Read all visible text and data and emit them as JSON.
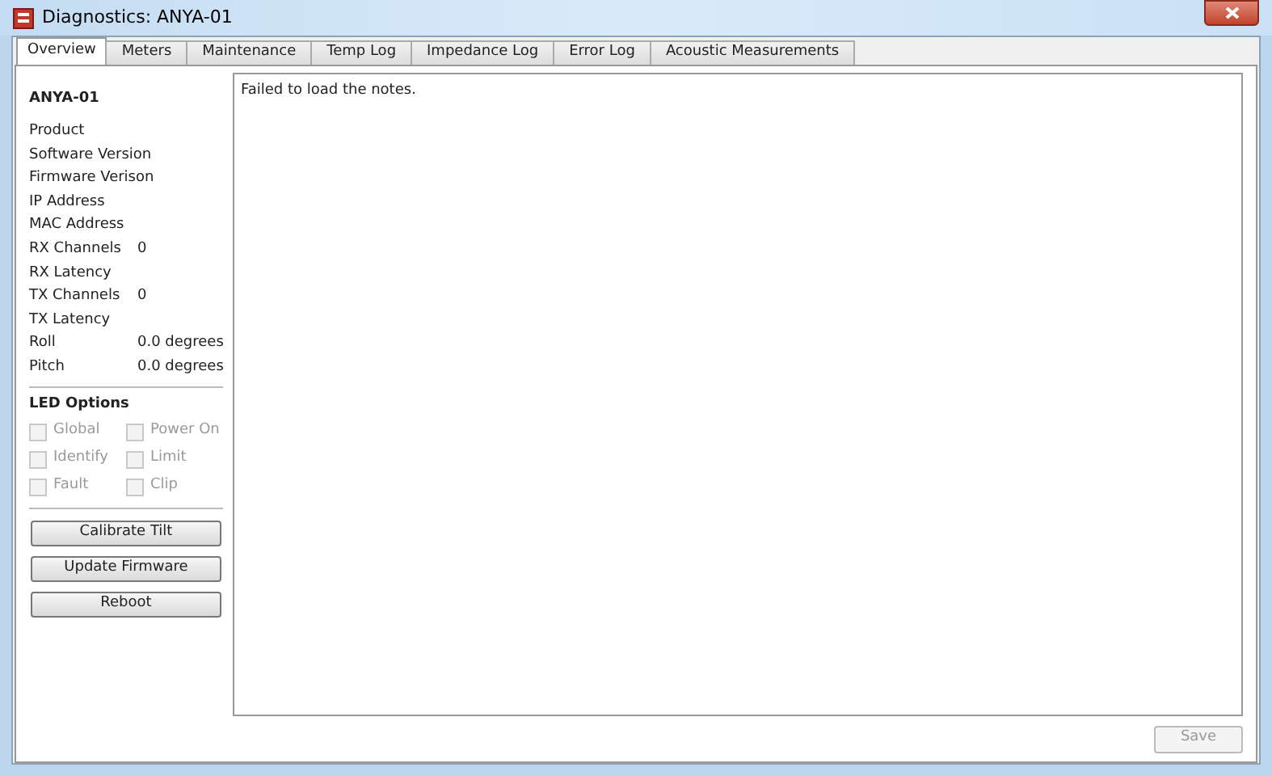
{
  "window": {
    "title": "Diagnostics: ANYA-01"
  },
  "tabs": [
    {
      "label": "Overview",
      "selected": true
    },
    {
      "label": "Meters",
      "selected": false
    },
    {
      "label": "Maintenance",
      "selected": false
    },
    {
      "label": "Temp Log",
      "selected": false
    },
    {
      "label": "Impedance Log",
      "selected": false
    },
    {
      "label": "Error Log",
      "selected": false
    },
    {
      "label": "Acoustic Measurements",
      "selected": false
    }
  ],
  "device": {
    "name": "ANYA-01",
    "properties": [
      {
        "label": "Product"
      },
      {
        "label": "Software Version"
      },
      {
        "label": "Firmware Verison"
      },
      {
        "label": "IP Address"
      },
      {
        "label": "MAC Address"
      },
      {
        "label": "RX Channels",
        "value": "0"
      },
      {
        "label": "RX Latency"
      },
      {
        "label": "TX Channels",
        "value": "0"
      },
      {
        "label": "TX Latency"
      },
      {
        "label": "Roll",
        "value": "0.0 degrees"
      },
      {
        "label": "Pitch",
        "value": "0.0 degrees"
      }
    ]
  },
  "led_options": {
    "title": "LED Options",
    "items": [
      {
        "label": "Global",
        "checked": false,
        "disabled": true
      },
      {
        "label": "Power On",
        "checked": false,
        "disabled": true
      },
      {
        "label": "Identify",
        "checked": false,
        "disabled": true
      },
      {
        "label": "Limit",
        "checked": false,
        "disabled": true
      },
      {
        "label": "Fault",
        "checked": false,
        "disabled": true
      },
      {
        "label": "Clip",
        "checked": false,
        "disabled": true
      }
    ]
  },
  "actions": [
    {
      "label": "Calibrate Tilt"
    },
    {
      "label": "Update Firmware"
    },
    {
      "label": "Reboot"
    }
  ],
  "notes": {
    "message": "Failed to load the notes."
  },
  "save_button": {
    "label": "Save",
    "disabled": true
  }
}
